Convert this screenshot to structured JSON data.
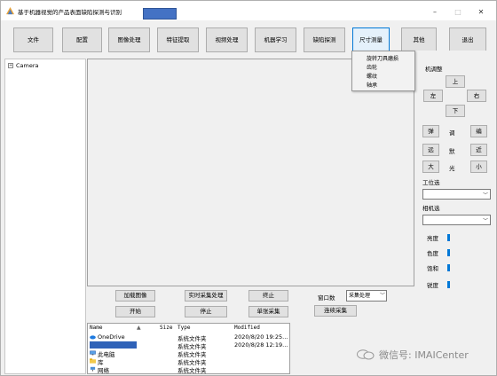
{
  "window": {
    "title": "基于机器视觉的产品表面缺陷探测与识别",
    "minimize": "–",
    "maximize": "□",
    "close": "✕"
  },
  "toolbar": {
    "items": [
      "文件",
      "配置",
      "图像处理",
      "特征提取",
      "视频处理",
      "机器学习",
      "缺陷探测",
      "尺寸测量",
      "其他",
      "退出"
    ],
    "active": "尺寸测量"
  },
  "dropdown": {
    "items": [
      "旋转刀具磨损",
      "齿轮",
      "螺纹",
      "轴承"
    ]
  },
  "tree": {
    "root": "Camera",
    "expander": "+"
  },
  "right_panel": {
    "title": "机调整",
    "pan": {
      "up": "上",
      "left": "左",
      "right": "右",
      "down": "下"
    },
    "grid": [
      [
        "弹",
        "调",
        "编"
      ],
      [
        "远",
        "默",
        "近"
      ],
      [
        "大",
        "光",
        "小"
      ]
    ],
    "position_label": "工位选",
    "camera_label": "相机选",
    "sliders": [
      {
        "label": "亮度",
        "value": 0
      },
      {
        "label": "色度",
        "value": 0
      },
      {
        "label": "饱和",
        "value": 0
      },
      {
        "label": "锐度",
        "value": 0
      }
    ]
  },
  "controls": {
    "load_image": "加载图像",
    "realtime": "实时采集处理",
    "stop_top": "终止",
    "window_count_label": "窗口数",
    "acquisition_mode": "采集处理",
    "start": "开始",
    "stop": "停止",
    "single": "单张采集",
    "continuous": "连续采集"
  },
  "file_list": {
    "headers": {
      "name": "Name",
      "size": "Size",
      "type": "Type",
      "modified": "Modified"
    },
    "sort_indicator": "▲",
    "rows": [
      {
        "name": "OneDrive",
        "type": "系统文件夹",
        "modified": "2020/8/20 19:25...",
        "icon": "cloud-icon"
      },
      {
        "name": "",
        "type": "系统文件夹",
        "modified": "2020/8/28 12:19...",
        "icon": "user-icon"
      },
      {
        "name": "此电脑",
        "type": "系统文件夹",
        "modified": "",
        "icon": "computer-icon"
      },
      {
        "name": "库",
        "type": "系统文件夹",
        "modified": "",
        "icon": "library-icon"
      },
      {
        "name": "网络",
        "type": "系统文件夹",
        "modified": "",
        "icon": "network-icon"
      }
    ]
  },
  "watermark": {
    "text": "微信号: IMAICenter"
  },
  "colors": {
    "accent": "#0078d7",
    "title_field": "#4472c4",
    "selected_row": "#2f62b8"
  }
}
